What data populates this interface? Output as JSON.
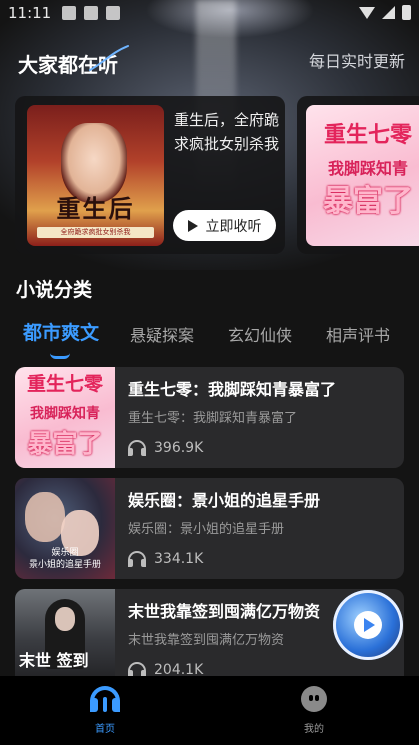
{
  "status_bar": {
    "time": "11:11"
  },
  "header": {
    "title": "大家都在听",
    "subtitle": "每日实时更新"
  },
  "banner": {
    "main": {
      "title": "重生后，全府跪求疯批女别杀我",
      "cover_text": "重生后",
      "cover_strip": "全府跪求疯批女别杀我",
      "button_label": "立即收听"
    },
    "next": {
      "cover_lines": [
        "重生七零",
        "我脚踩知青",
        "暴富了"
      ]
    }
  },
  "section": {
    "title": "小说分类"
  },
  "tabs": [
    {
      "label": "都市爽文",
      "active": true
    },
    {
      "label": "悬疑探案",
      "active": false
    },
    {
      "label": "玄幻仙侠",
      "active": false
    },
    {
      "label": "相声评书",
      "active": false
    }
  ],
  "list": [
    {
      "title": "重生七零：我脚踩知青暴富了",
      "description": "重生七零：我脚踩知青暴富了",
      "plays": "396.9K",
      "cover_lines": [
        "重生七零",
        "我脚踩知青",
        "暴富了"
      ]
    },
    {
      "title": "娱乐圈：景小姐的追星手册",
      "description": "娱乐圈：景小姐的追星手册",
      "plays": "334.1K",
      "cover_lines": [
        "娱乐圈",
        "景小姐的追星手册"
      ]
    },
    {
      "title": "末世我靠签到囤满亿万物资",
      "description": "末世我靠签到囤满亿万物资",
      "plays": "204.1K",
      "cover_lines": [
        "末世 签到"
      ]
    }
  ],
  "bottom_nav": [
    {
      "label": "首页",
      "icon": "headphones-icon",
      "active": true
    },
    {
      "label": "我的",
      "icon": "profile-face-icon",
      "active": false
    }
  ],
  "colors": {
    "accent": "#3b9bff",
    "card_bg": "#2a2a2c",
    "page_bg": "#141414"
  }
}
